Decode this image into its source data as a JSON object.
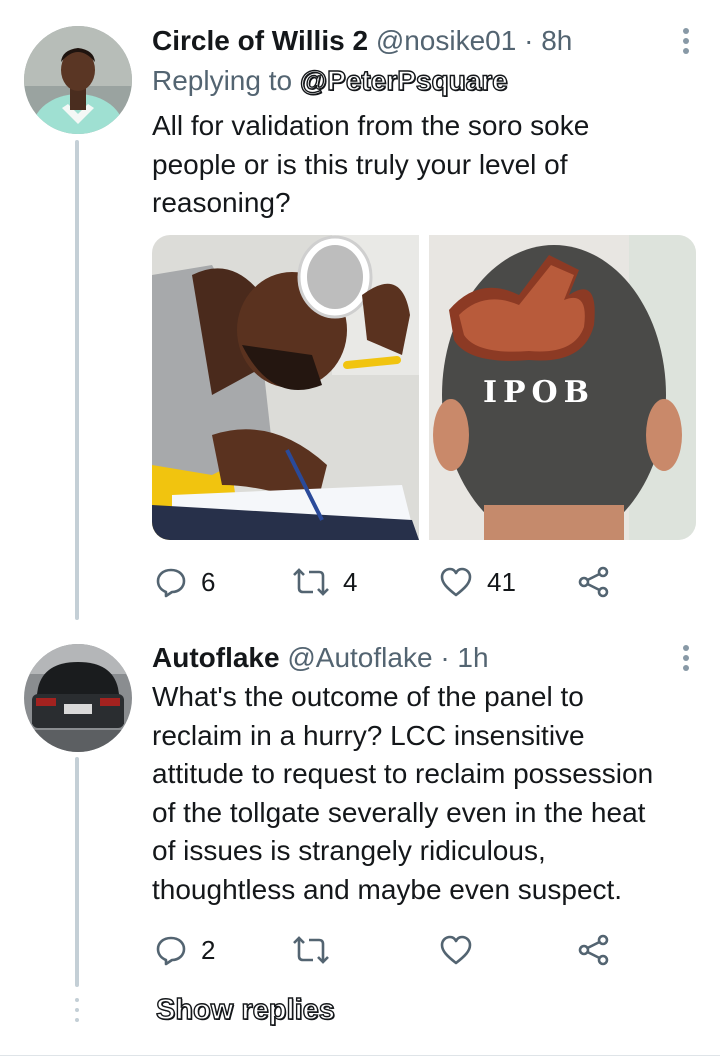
{
  "tweets": [
    {
      "display_name": "Circle of Willis 2",
      "handle": "@nosike01",
      "separator": "·",
      "time": "8h",
      "replying_prefix": "Replying to",
      "replying_handle": "@PeterPsquare",
      "text": "All for validation from the soro soke\npeople or is this truly your level of\nreasoning?",
      "media_overlay_text": "IPOB",
      "replies": "6",
      "retweets": "4",
      "likes": "41"
    },
    {
      "display_name": "Autoflake",
      "handle": "@Autoflake",
      "separator": "·",
      "time": "1h",
      "text": "What's the outcome of the panel to\nreclaim in a hurry? LCC insensitive\nattitude to request to reclaim possession\nof the tollgate severally even in the heat\nof issues is strangely ridiculous,\nthoughtless and maybe even suspect.",
      "replies": "2",
      "retweets": "",
      "likes": ""
    }
  ],
  "show_replies": "Show replies",
  "colors": {
    "icon": "#536471",
    "thread_line": "#c4cfd6",
    "text": "#14171a"
  }
}
